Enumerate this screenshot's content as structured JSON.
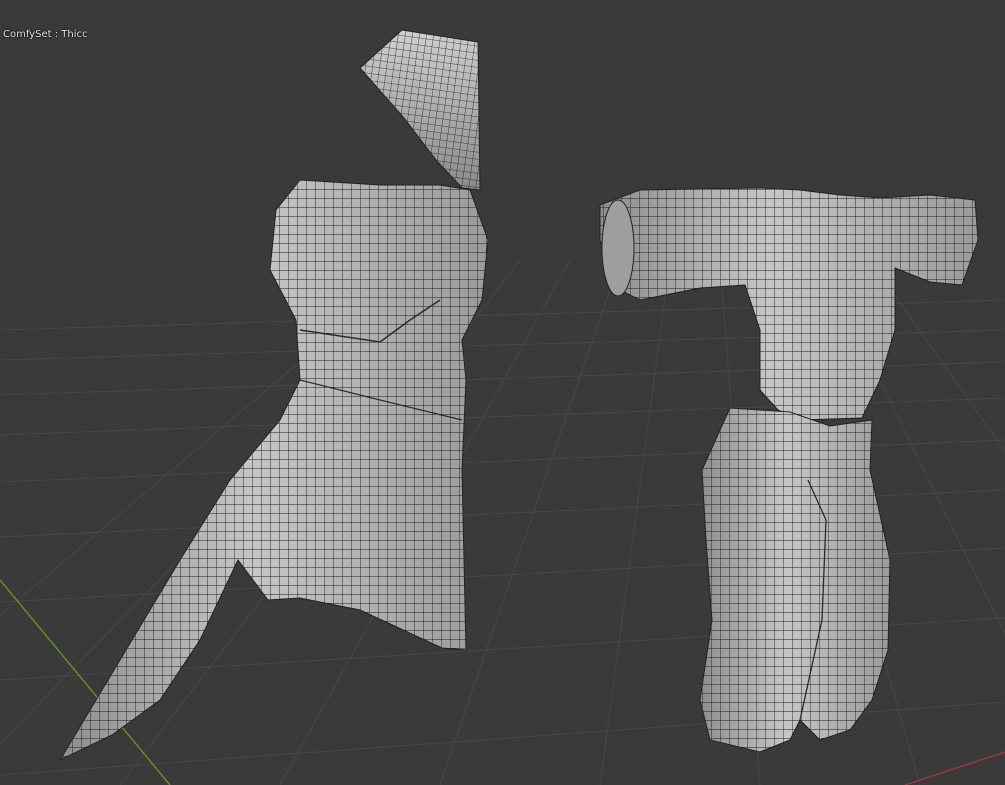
{
  "viewport": {
    "object_label": "ComfySet : Thicc",
    "background_color": "#3a3a3a",
    "grid_color": "#474747",
    "x_axis_color": "#9a3a3a",
    "y_axis_color": "#6b8f2a",
    "mesh_fill": "#b9b9b9",
    "mesh_wire": "#1e1e1e"
  },
  "objects": [
    {
      "name": "hood"
    },
    {
      "name": "dress"
    },
    {
      "name": "shirt"
    },
    {
      "name": "pants"
    }
  ]
}
